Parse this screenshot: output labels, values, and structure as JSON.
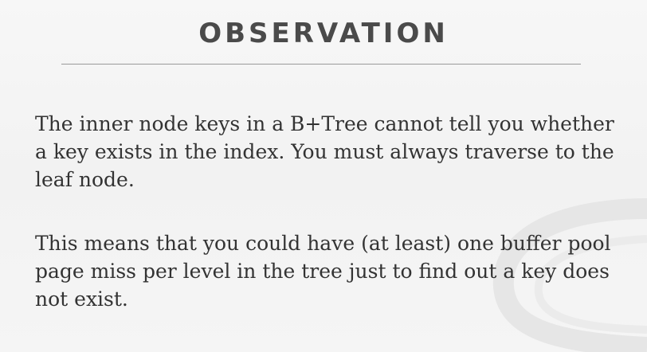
{
  "slide": {
    "title": "OBSERVATION",
    "paragraphs": [
      "The inner node keys in a B+Tree cannot tell you whether a key exists in the index. You must always traverse to the leaf node.",
      "This means that you could have (at least) one buffer pool page miss per level in the tree just to find out a key does not exist."
    ]
  },
  "colors": {
    "background": "#f4f4f4",
    "title": "#4a4a4a",
    "text": "#333333",
    "rule": "#9a9a9a"
  }
}
